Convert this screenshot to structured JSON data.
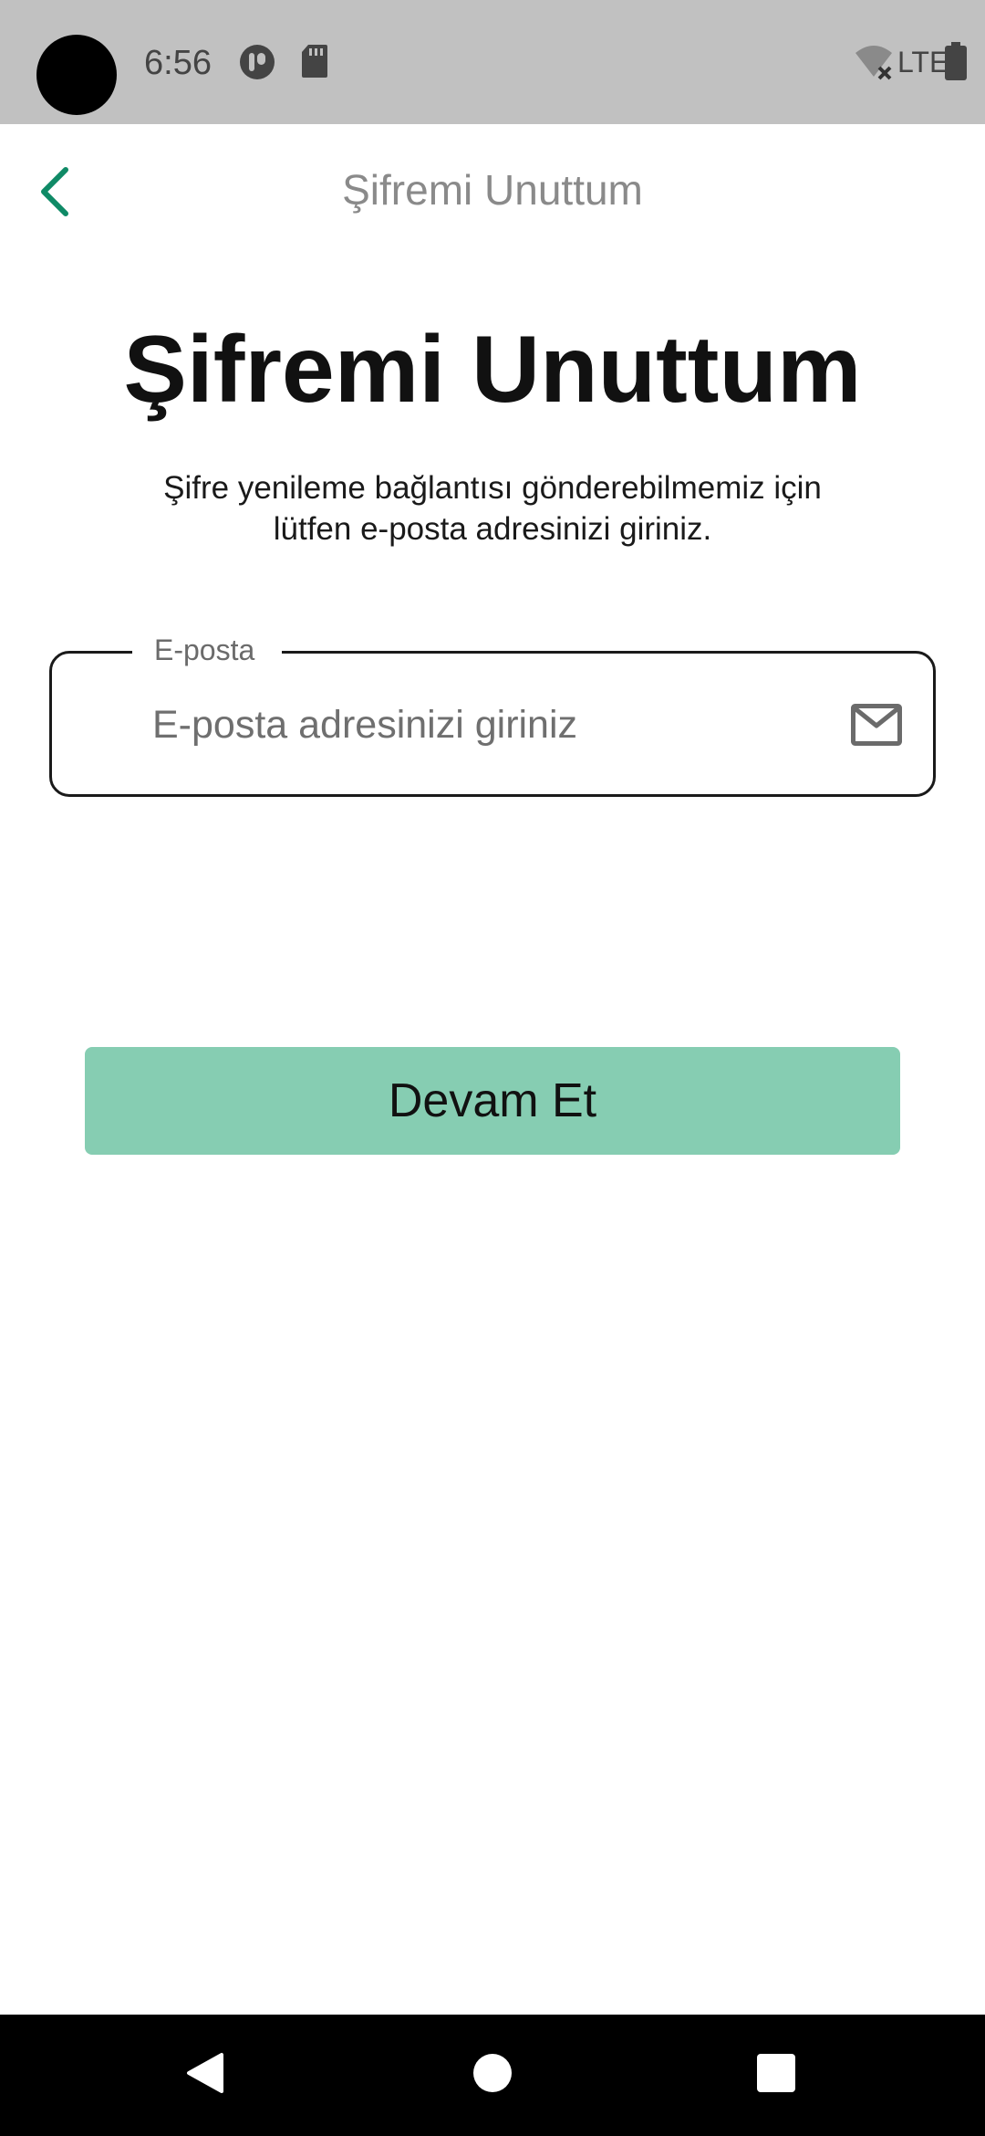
{
  "status_bar": {
    "time": "6:56",
    "network_label": "LTE",
    "icons": [
      "camera-cutout",
      "app-notification-icon",
      "sd-card-icon",
      "wifi-off-icon",
      "battery-icon"
    ]
  },
  "app_bar": {
    "title": "Şifremi Unuttum",
    "back_icon": "chevron-left-icon"
  },
  "main": {
    "heading": "Şifremi Unuttum",
    "description_line1": "Şifre yenileme bağlantısı gönderebilmemiz için",
    "description_line2": "lütfen e-posta adresinizi giriniz.",
    "email_field": {
      "label": "E-posta",
      "placeholder": "E-posta adresinizi giriniz",
      "value": "",
      "icon": "mail-icon"
    },
    "continue_label": "Devam Et"
  },
  "nav_bar": {
    "buttons": [
      "back-nav-icon",
      "home-nav-icon",
      "recents-nav-icon"
    ]
  },
  "colors": {
    "accent": "#0f8a66",
    "button_bg": "#86cdb2",
    "status_bar_bg": "#c1c1c1",
    "nav_bar_bg": "#000000"
  }
}
